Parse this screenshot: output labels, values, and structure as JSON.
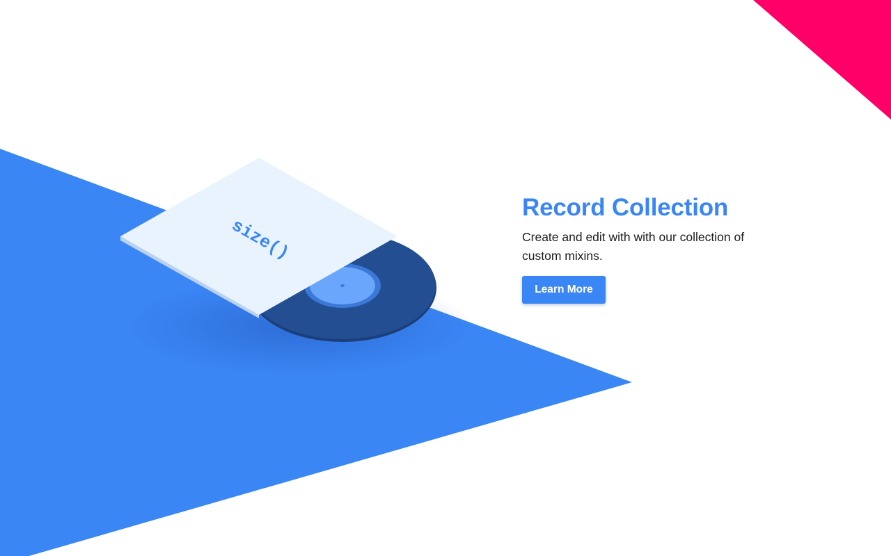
{
  "hero": {
    "title": "Record Collection",
    "description": "Create and edit with with our collection of custom mixins.",
    "cta_label": "Learn More"
  },
  "illustration": {
    "sleeve_text": "size()"
  },
  "colors": {
    "accent": "#3a86f5",
    "magenta": "#ff0068",
    "record": "#234e91",
    "sleeve": "#e9f3fd",
    "label": "#6aa6fb"
  },
  "icons": {
    "illustration": "vinyl-record-illustration"
  }
}
